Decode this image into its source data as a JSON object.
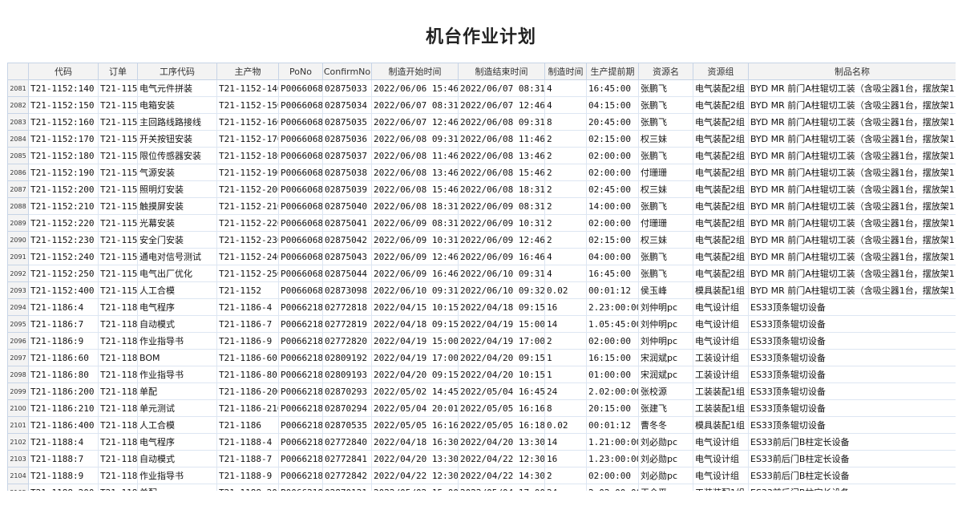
{
  "title": "机台作业计划",
  "columns": [
    "代码",
    "订单",
    "工序代码",
    "主产物",
    "PoNo",
    "ConfirmNo",
    "制造开始时间",
    "制造结束时间",
    "制造时间",
    "生产提前期",
    "资源名",
    "资源组",
    "制品名称"
  ],
  "rows": [
    {
      "n": "2081",
      "c": [
        "T21-1152:140",
        "T21-1152",
        "电气元件拼装",
        "T21-1152-140",
        "P00660686",
        "02875033",
        "2022/06/06 15:46:12",
        "2022/06/07 08:31:12",
        "4",
        "16:45:00",
        "张鹏飞",
        "电气装配2组",
        "BYD MR 前门A柱辊切工装（含吸尘器1台，摆放架1台）"
      ]
    },
    {
      "n": "2082",
      "c": [
        "T21-1152:150",
        "T21-1152",
        "电箱安装",
        "T21-1152-150",
        "P00660686",
        "02875034",
        "2022/06/07 08:31:12",
        "2022/06/07 12:46:12",
        "4",
        "04:15:00",
        "张鹏飞",
        "电气装配2组",
        "BYD MR 前门A柱辊切工装（含吸尘器1台，摆放架1台）"
      ]
    },
    {
      "n": "2083",
      "c": [
        "T21-1152:160",
        "T21-1152",
        "主回路线路接线",
        "T21-1152-160",
        "P00660686",
        "02875035",
        "2022/06/07 12:46:12",
        "2022/06/08 09:31:12",
        "8",
        "20:45:00",
        "张鹏飞",
        "电气装配2组",
        "BYD MR 前门A柱辊切工装（含吸尘器1台，摆放架1台）"
      ]
    },
    {
      "n": "2084",
      "c": [
        "T21-1152:170",
        "T21-1152",
        "开关按钮安装",
        "T21-1152-170",
        "P00660686",
        "02875036",
        "2022/06/08 09:31:12",
        "2022/06/08 11:46:12",
        "2",
        "02:15:00",
        "权三妹",
        "电气装配2组",
        "BYD MR 前门A柱辊切工装（含吸尘器1台，摆放架1台）"
      ]
    },
    {
      "n": "2085",
      "c": [
        "T21-1152:180",
        "T21-1152",
        "限位传感器安装",
        "T21-1152-180",
        "P00660686",
        "02875037",
        "2022/06/08 11:46:12",
        "2022/06/08 13:46:12",
        "2",
        "02:00:00",
        "张鹏飞",
        "电气装配2组",
        "BYD MR 前门A柱辊切工装（含吸尘器1台，摆放架1台）"
      ]
    },
    {
      "n": "2086",
      "c": [
        "T21-1152:190",
        "T21-1152",
        "气源安装",
        "T21-1152-190",
        "P00660686",
        "02875038",
        "2022/06/08 13:46:12",
        "2022/06/08 15:46:12",
        "2",
        "02:00:00",
        "付珊珊",
        "电气装配2组",
        "BYD MR 前门A柱辊切工装（含吸尘器1台，摆放架1台）"
      ]
    },
    {
      "n": "2087",
      "c": [
        "T21-1152:200",
        "T21-1152",
        "照明灯安装",
        "T21-1152-200",
        "P00660686",
        "02875039",
        "2022/06/08 15:46:12",
        "2022/06/08 18:31:12",
        "2",
        "02:45:00",
        "权三妹",
        "电气装配2组",
        "BYD MR 前门A柱辊切工装（含吸尘器1台，摆放架1台）"
      ]
    },
    {
      "n": "2088",
      "c": [
        "T21-1152:210",
        "T21-1152",
        "触摸屏安装",
        "T21-1152-210",
        "P00660686",
        "02875040",
        "2022/06/08 18:31:12",
        "2022/06/09 08:31:12",
        "2",
        "14:00:00",
        "张鹏飞",
        "电气装配2组",
        "BYD MR 前门A柱辊切工装（含吸尘器1台，摆放架1台）"
      ]
    },
    {
      "n": "2089",
      "c": [
        "T21-1152:220",
        "T21-1152",
        "光幕安装",
        "T21-1152-220",
        "P00660686",
        "02875041",
        "2022/06/09 08:31:12",
        "2022/06/09 10:31:12",
        "2",
        "02:00:00",
        "付珊珊",
        "电气装配2组",
        "BYD MR 前门A柱辊切工装（含吸尘器1台，摆放架1台）"
      ]
    },
    {
      "n": "2090",
      "c": [
        "T21-1152:230",
        "T21-1152",
        "安全门安装",
        "T21-1152-230",
        "P00660686",
        "02875042",
        "2022/06/09 10:31:12",
        "2022/06/09 12:46:12",
        "2",
        "02:15:00",
        "权三妹",
        "电气装配2组",
        "BYD MR 前门A柱辊切工装（含吸尘器1台，摆放架1台）"
      ]
    },
    {
      "n": "2091",
      "c": [
        "T21-1152:240",
        "T21-1152",
        "通电对信号测试",
        "T21-1152-240",
        "P00660686",
        "02875043",
        "2022/06/09 12:46:12",
        "2022/06/09 16:46:12",
        "4",
        "04:00:00",
        "张鹏飞",
        "电气装配2组",
        "BYD MR 前门A柱辊切工装（含吸尘器1台，摆放架1台）"
      ]
    },
    {
      "n": "2092",
      "c": [
        "T21-1152:250",
        "T21-1152",
        "电气出厂优化",
        "T21-1152-250",
        "P00660686",
        "02875044",
        "2022/06/09 16:46:12",
        "2022/06/10 09:31:12",
        "4",
        "16:45:00",
        "张鹏飞",
        "电气装配2组",
        "BYD MR 前门A柱辊切工装（含吸尘器1台，摆放架1台）"
      ]
    },
    {
      "n": "2093",
      "c": [
        "T21-1152:400",
        "T21-1152",
        "人工合模",
        "T21-1152",
        "P00660686",
        "02873098",
        "2022/06/10 09:31:12",
        "2022/06/10 09:32:24",
        "0.02",
        "00:01:12",
        "侯玉峰",
        "模具装配1组",
        "BYD MR 前门A柱辊切工装（含吸尘器1台，摆放架1台）"
      ]
    },
    {
      "n": "2094",
      "c": [
        "T21-1186:4",
        "T21-1186",
        "电气程序",
        "T21-1186-4",
        "P00662183",
        "02772818",
        "2022/04/15 10:15:00",
        "2022/04/18 09:15:00",
        "16",
        "2.23:00:00",
        "刘仲明pc",
        "电气设计组",
        "ES33顶条辊切设备"
      ]
    },
    {
      "n": "2095",
      "c": [
        "T21-1186:7",
        "T21-1186",
        "自动模式",
        "T21-1186-7",
        "P00662183",
        "02772819",
        "2022/04/18 09:15:00",
        "2022/04/19 15:00:00",
        "14",
        "1.05:45:00",
        "刘仲明pc",
        "电气设计组",
        "ES33顶条辊切设备"
      ]
    },
    {
      "n": "2096",
      "c": [
        "T21-1186:9",
        "T21-1186",
        "作业指导书",
        "T21-1186-9",
        "P00662183",
        "02772820",
        "2022/04/19 15:00:00",
        "2022/04/19 17:00:00",
        "2",
        "02:00:00",
        "刘仲明pc",
        "电气设计组",
        "ES33顶条辊切设备"
      ]
    },
    {
      "n": "2097",
      "c": [
        "T21-1186:60",
        "T21-1186",
        "BOM",
        "T21-1186-60",
        "P00662183",
        "02809192",
        "2022/04/19 17:00:00",
        "2022/04/20 09:15:00",
        "1",
        "16:15:00",
        "宋润斌pc",
        "工装设计组",
        "ES33顶条辊切设备"
      ]
    },
    {
      "n": "2098",
      "c": [
        "T21-1186:80",
        "T21-1186",
        "作业指导书",
        "T21-1186-80",
        "P00662183",
        "02809193",
        "2022/04/20 09:15:00",
        "2022/04/20 10:15:00",
        "1",
        "01:00:00",
        "宋润斌pc",
        "工装设计组",
        "ES33顶条辊切设备"
      ]
    },
    {
      "n": "2099",
      "c": [
        "T21-1186:200",
        "T21-1186",
        "单配",
        "T21-1186-200",
        "P00662183",
        "02870293",
        "2022/05/02 14:45:00",
        "2022/05/04 16:45:00",
        "24",
        "2.02:00:00",
        "张校源",
        "工装装配1组",
        "ES33顶条辊切设备"
      ]
    },
    {
      "n": "2100",
      "c": [
        "T21-1186:210",
        "T21-1186",
        "单元测试",
        "T21-1186-210",
        "P00662183",
        "02870294",
        "2022/05/04 20:01:48",
        "2022/05/05 16:16:48",
        "8",
        "20:15:00",
        "张建飞",
        "工装装配1组",
        "ES33顶条辊切设备"
      ]
    },
    {
      "n": "2101",
      "c": [
        "T21-1186:400",
        "T21-1186",
        "人工合模",
        "T21-1186",
        "P00662183",
        "02870535",
        "2022/05/05 16:16:48",
        "2022/05/05 16:18:00",
        "0.02",
        "00:01:12",
        "曹冬冬",
        "模具装配1组",
        "ES33顶条辊切设备"
      ]
    },
    {
      "n": "2102",
      "c": [
        "T21-1188:4",
        "T21-1188",
        "电气程序",
        "T21-1188-4",
        "P00662186",
        "02772840",
        "2022/04/18 16:30:00",
        "2022/04/20 13:30:00",
        "14",
        "1.21:00:00",
        "刘必勋pc",
        "电气设计组",
        "ES33前后门B柱定长设备"
      ]
    },
    {
      "n": "2103",
      "c": [
        "T21-1188:7",
        "T21-1188",
        "自动模式",
        "T21-1188-7",
        "P00662186",
        "02772841",
        "2022/04/20 13:30:00",
        "2022/04/22 12:30:00",
        "16",
        "1.23:00:00",
        "刘必勋pc",
        "电气设计组",
        "ES33前后门B柱定长设备"
      ]
    },
    {
      "n": "2104",
      "c": [
        "T21-1188:9",
        "T21-1188",
        "作业指导书",
        "T21-1188-9",
        "P00662186",
        "02772842",
        "2022/04/22 12:30:00",
        "2022/04/22 14:30:00",
        "2",
        "02:00:00",
        "刘必勋pc",
        "电气设计组",
        "ES33前后门B柱定长设备"
      ]
    },
    {
      "n": "2105",
      "c": [
        "T21-1188:200",
        "T21-1188",
        "单配",
        "T21-1188-200",
        "P00662186",
        "02870121",
        "2022/05/02 15:00:00",
        "2022/05/04 17:00:00",
        "24",
        "2.02:00:00",
        "王会平",
        "工装装配1组",
        "ES33前后门B柱定长设备"
      ]
    }
  ]
}
